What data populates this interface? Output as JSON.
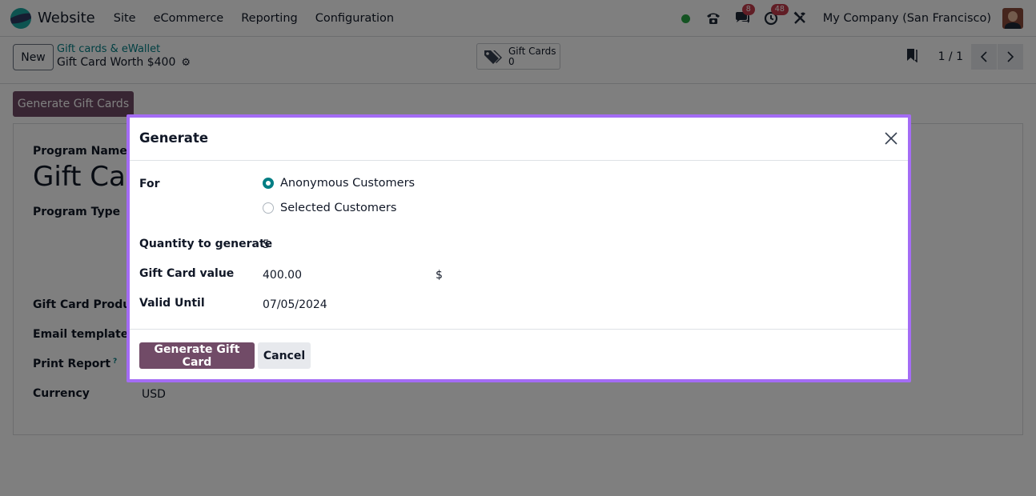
{
  "navbar": {
    "app_name": "Website",
    "menu": [
      "Site",
      "eCommerce",
      "Reporting",
      "Configuration"
    ],
    "messages_badge": "8",
    "activities_badge": "48",
    "company": "My Company (San Francisco)",
    "status_color": "#28a745"
  },
  "control_panel": {
    "new_label": "New",
    "breadcrumb_parent": "Gift cards & eWallet",
    "breadcrumb_current": "Gift Card Worth $400",
    "smart_button": {
      "label": "Gift Cards",
      "count": "0"
    },
    "pager_value": "1 / 1"
  },
  "form": {
    "generate_button": "Generate Gift Cards",
    "program_name_label": "Program Name",
    "program_name_visible": "Gift Car",
    "program_type_label": "Program Type",
    "gift_card_products_label": "Gift Card Products",
    "email_template_label": "Email template",
    "print_report_label": "Print Report",
    "print_report_help": "?",
    "currency_label": "Currency",
    "currency_value": "USD"
  },
  "dialog": {
    "title": "Generate",
    "for_label": "For",
    "for_options": [
      {
        "label": "Anonymous Customers",
        "selected": true
      },
      {
        "label": "Selected Customers",
        "selected": false
      }
    ],
    "quantity_label": "Quantity to generate",
    "quantity_value": "5",
    "value_label": "Gift Card value",
    "value_amount": "400.00",
    "value_currency": "$",
    "valid_until_label": "Valid Until",
    "valid_until_value": "07/05/2024",
    "primary_button": "Generate Gift Card",
    "cancel_button": "Cancel"
  },
  "colors": {
    "primary": "#714b67",
    "accent": "#017e84",
    "focus_border": "#a46cf5",
    "badge": "#c33b4a"
  }
}
